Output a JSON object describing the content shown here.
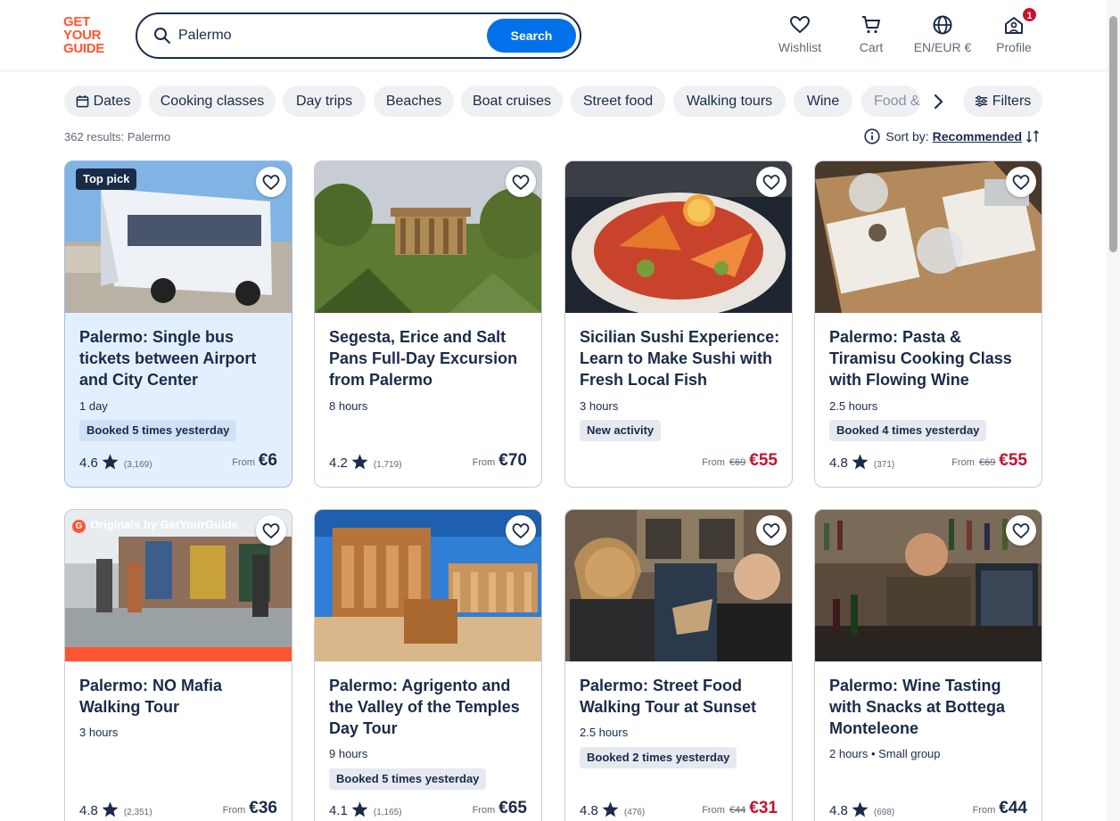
{
  "header": {
    "logo_lines": [
      "GET",
      "YOUR",
      "GUIDE"
    ],
    "search_value": "Palermo",
    "search_button": "Search",
    "nav": [
      {
        "label": "Wishlist",
        "icon": "heart-icon"
      },
      {
        "label": "Cart",
        "icon": "cart-icon"
      },
      {
        "label": "EN/EUR €",
        "icon": "globe-icon"
      },
      {
        "label": "Profile",
        "icon": "profile-icon",
        "badge": "1"
      }
    ]
  },
  "filters": {
    "chips": [
      "Dates",
      "Cooking classes",
      "Day trips",
      "Beaches",
      "Boat cruises",
      "Street food",
      "Walking tours",
      "Wine",
      "Food &"
    ],
    "filters_label": "Filters"
  },
  "results_text": "362 results: Palermo",
  "sort": {
    "label": "Sort by:",
    "value": "Recommended"
  },
  "colors": {
    "brand": "#ff5533",
    "accent": "#0071eb",
    "sale": "#c8102e",
    "text": "#1a2b49"
  },
  "cards": [
    {
      "badge": "Top pick",
      "title": "Palermo: Single bus tickets between Airport and City Center",
      "duration": "1 day",
      "pill": "Booked 5 times yesterday",
      "rating": "4.6",
      "reviews": "(3,169)",
      "from": "From",
      "old_price": "",
      "price": "€6",
      "image": "bus"
    },
    {
      "title": "Segesta, Erice and Salt Pans Full-Day Excursion from Palermo",
      "duration": "8 hours",
      "rating": "4.2",
      "reviews": "(1,719)",
      "from": "From",
      "old_price": "",
      "price": "€70",
      "image": "temple-garden"
    },
    {
      "title": "Sicilian Sushi Experience: Learn to Make Sushi with Fresh Local Fish",
      "duration": "3 hours",
      "pill": "New activity",
      "from": "From",
      "old_price": "€69",
      "price": "€55",
      "image": "sushi"
    },
    {
      "title": "Palermo: Pasta & Tiramisu Cooking Class with Flowing Wine",
      "duration": "2.5 hours",
      "pill": "Booked 4 times yesterday",
      "rating": "4.8",
      "reviews": "(371)",
      "from": "From",
      "old_price": "€69",
      "price": "€55",
      "image": "pasta-table"
    },
    {
      "badge_originals": "Originals by GetYourGuide",
      "title": "Palermo: NO Mafia Walking Tour",
      "duration": "3 hours",
      "rating": "4.8",
      "reviews": "(2,351)",
      "from": "From",
      "old_price": "",
      "price": "€36",
      "image": "mural-street"
    },
    {
      "title": "Palermo: Agrigento and the Valley of the Temples Day Tour",
      "duration": "9 hours",
      "pill": "Booked 5 times yesterday",
      "rating": "4.1",
      "reviews": "(1,165)",
      "from": "From",
      "old_price": "",
      "price": "€65",
      "image": "greek-temple"
    },
    {
      "title": "Palermo: Street Food Walking Tour at Sunset",
      "duration": "2.5 hours",
      "pill": "Booked 2 times yesterday",
      "rating": "4.8",
      "reviews": "(476)",
      "from": "From",
      "old_price": "€44",
      "price": "€31",
      "image": "street-food"
    },
    {
      "title": "Palermo: Wine Tasting with Snacks at Bottega Monteleone",
      "duration": "2 hours • Small group",
      "rating": "4.8",
      "reviews": "(698)",
      "from": "From",
      "old_price": "",
      "price": "€44",
      "image": "wine-bar"
    }
  ]
}
